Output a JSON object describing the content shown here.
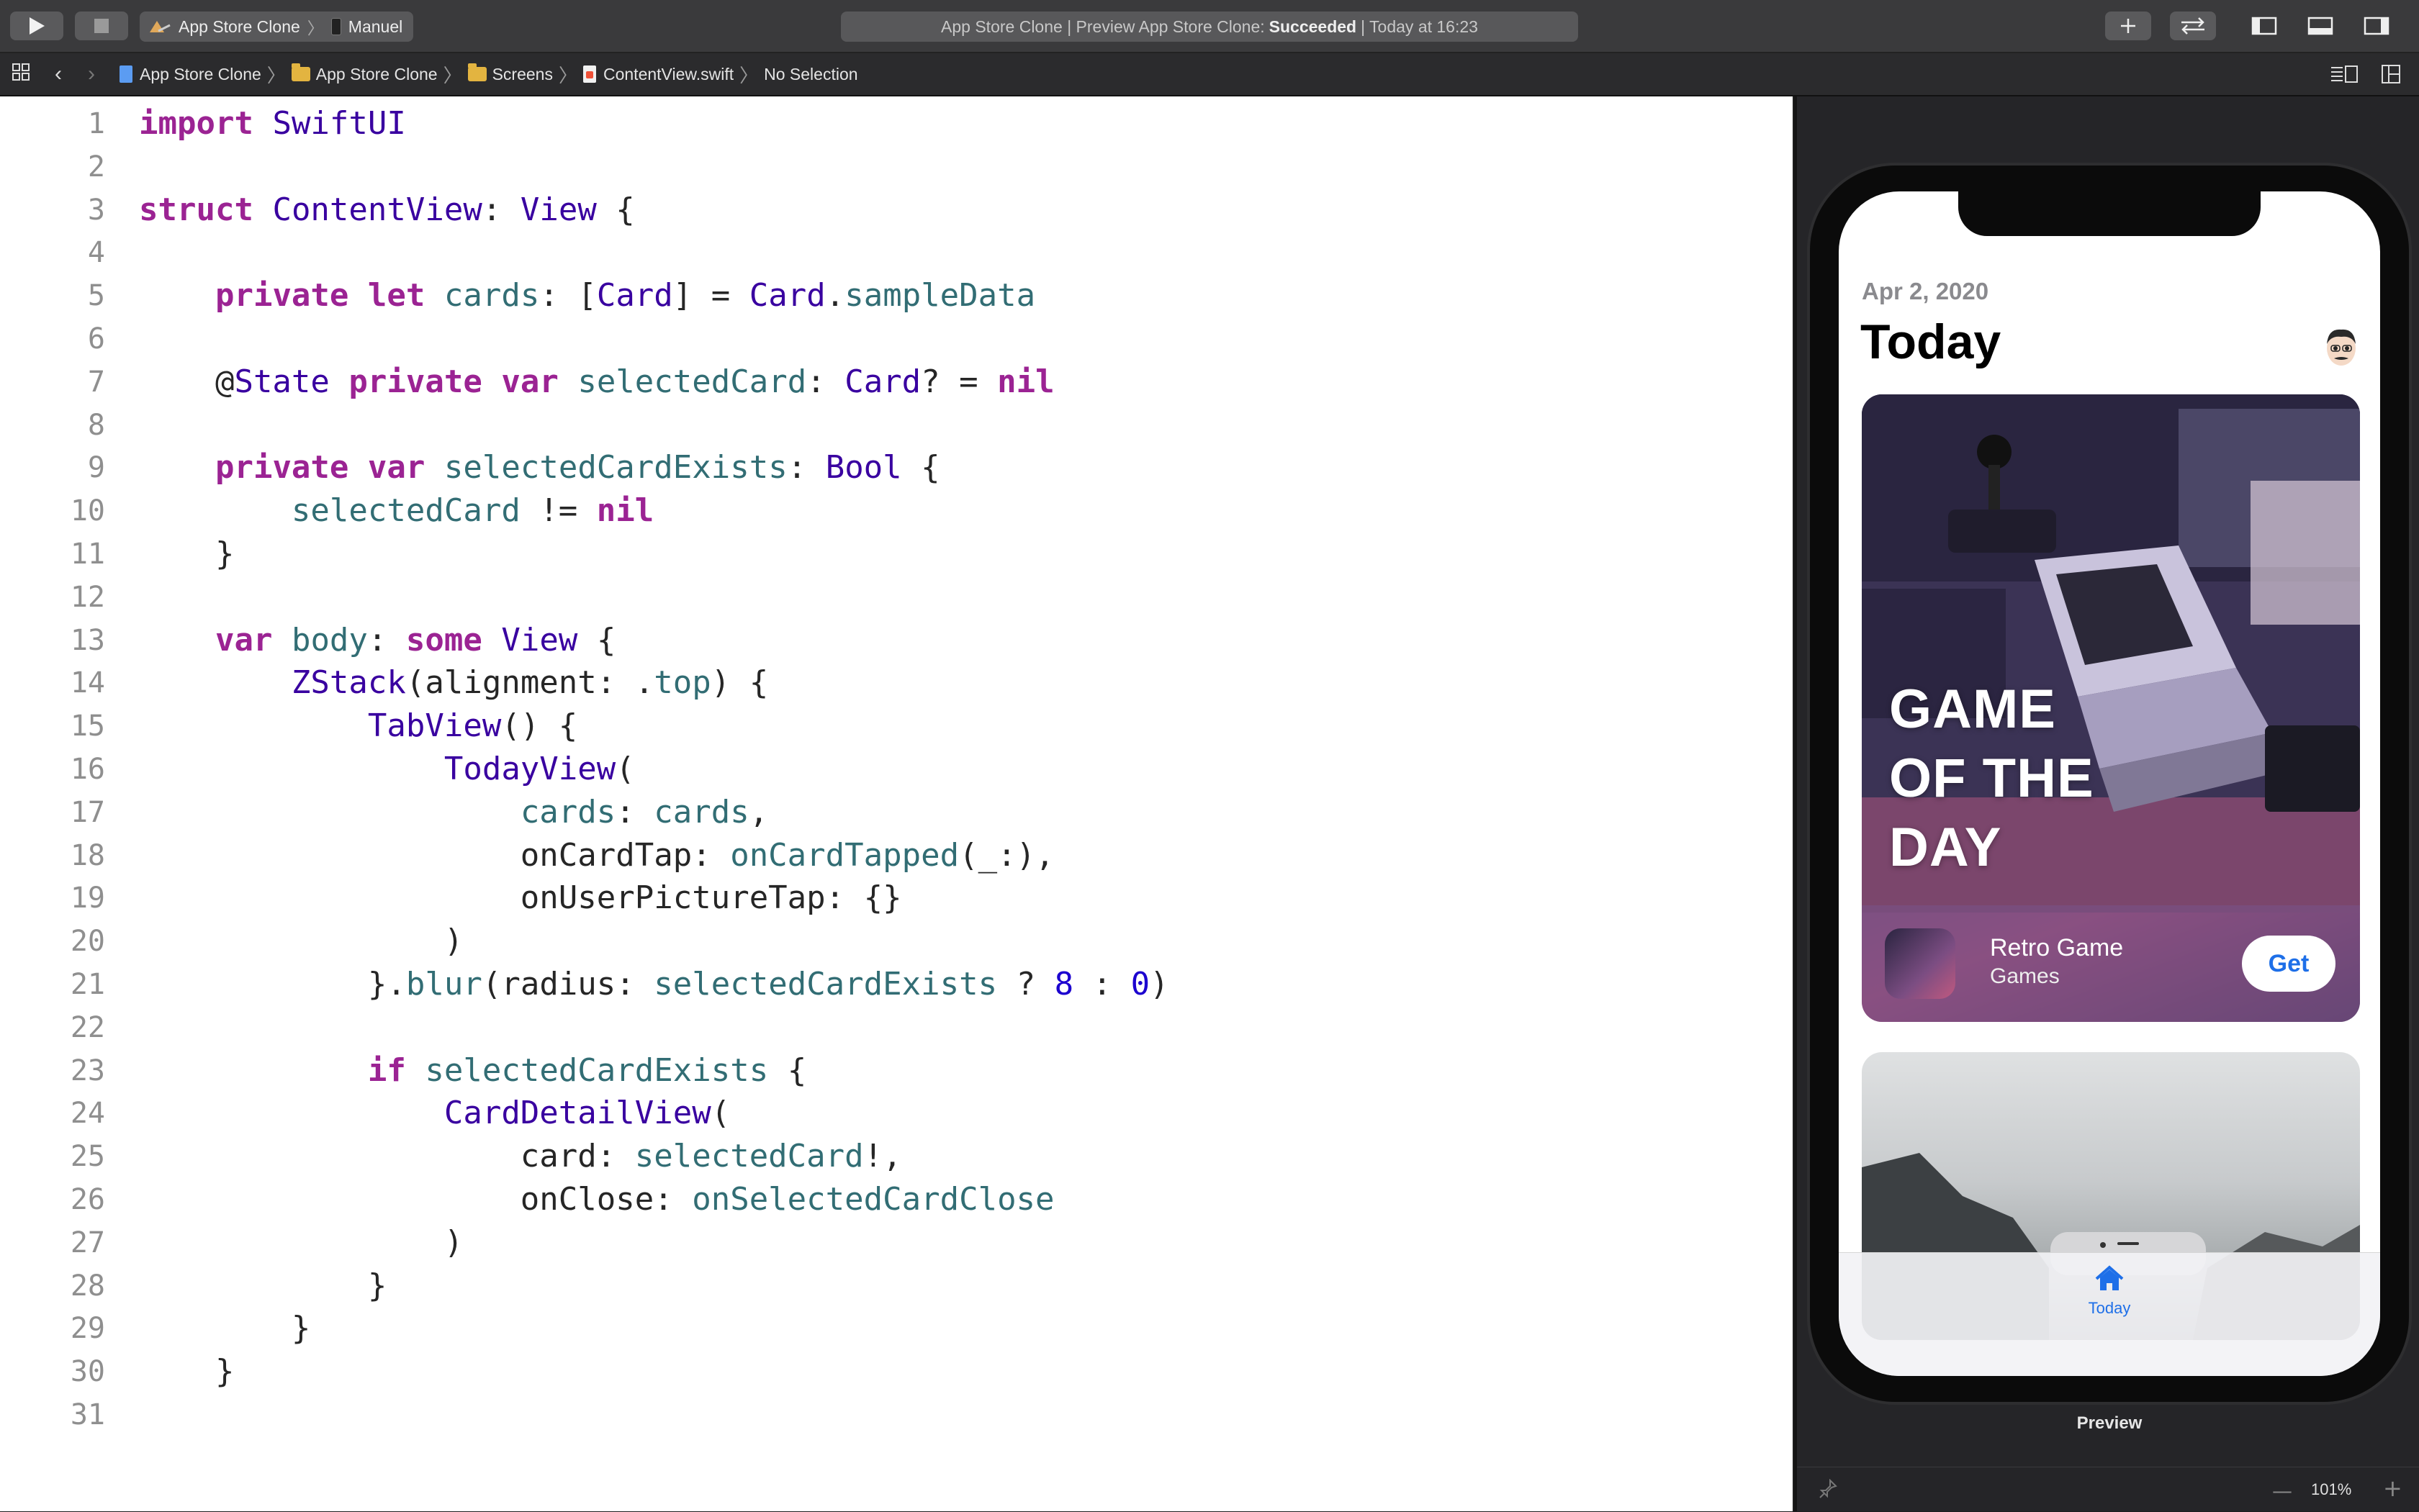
{
  "toolbar": {
    "scheme_project": "App Store Clone",
    "scheme_device": "Manuel",
    "status_prefix": "App Store Clone | Preview App Store Clone:",
    "status_result": "Succeeded",
    "status_suffix": "| Today at 16:23"
  },
  "breadcrumb": [
    "App Store Clone",
    "App Store Clone",
    "Screens",
    "ContentView.swift",
    "No Selection"
  ],
  "code_lines": [
    "import SwiftUI",
    "",
    "struct ContentView: View {",
    "",
    "    private let cards: [Card] = Card.sampleData",
    "",
    "    @State private var selectedCard: Card? = nil",
    "",
    "    private var selectedCardExists: Bool {",
    "        selectedCard != nil",
    "    }",
    "",
    "    var body: some View {",
    "        ZStack(alignment: .top) {",
    "            TabView() {",
    "                TodayView(",
    "                    cards: cards,",
    "                    onCardTap: onCardTapped(_:),",
    "                    onUserPictureTap: {}",
    "                )",
    "            }.blur(radius: selectedCardExists ? 8 : 0)",
    "",
    "            if selectedCardExists {",
    "                CardDetailView(",
    "                    card: selectedCard!,",
    "                    onClose: onSelectedCardClose",
    "                )",
    "            }",
    "        }",
    "    }",
    ""
  ],
  "preview": {
    "date": "Apr 2, 2020",
    "title": "Today",
    "card_headline": "GAME OF THE DAY",
    "app_name": "Retro Game",
    "app_category": "Games",
    "get_label": "Get",
    "tab_today": "Today",
    "label": "Preview",
    "zoom": "101%"
  },
  "colors": {
    "keyword": "#9b2393",
    "type": "#3900a0",
    "property": "#326d74",
    "number": "#1c00cf",
    "accent": "#1e6fe8"
  }
}
